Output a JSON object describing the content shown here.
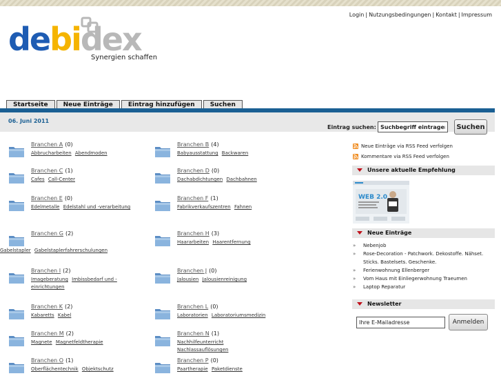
{
  "toplinks": [
    "Login",
    "Nutzungsbedingungen",
    "Kontakt",
    "Impressum"
  ],
  "logo": {
    "part1": "de",
    "part2": "bi",
    "part3": "dex",
    "tagline": "Synergien schaffen"
  },
  "tabs": [
    "Startseite",
    "Neue Einträge",
    "Eintrag hinzufügen",
    "Suchen"
  ],
  "date": "06. Juni 2011",
  "search": {
    "label": "Eintrag suchen:",
    "value": "Suchbegriff eintragen",
    "button": "Suchen"
  },
  "categories": [
    {
      "name": "Branchen A",
      "count": "(0)",
      "subs": [
        "Abbrucharbeiten",
        "Abendmoden"
      ]
    },
    {
      "name": "Branchen B",
      "count": "(4)",
      "subs": [
        "Babyausstattung",
        "Backwaren"
      ]
    },
    {
      "name": "Branchen C",
      "count": "(1)",
      "subs": [
        "Cafes",
        "Call-Center"
      ]
    },
    {
      "name": "Branchen D",
      "count": "(0)",
      "subs": [
        "Dachabdichtungen",
        "Dachbahnen"
      ]
    },
    {
      "name": "Branchen E",
      "count": "(0)",
      "subs": [
        "Edelmetalle",
        "Edelstahl und -verarbeitung"
      ]
    },
    {
      "name": "Branchen F",
      "count": "(1)",
      "subs": [
        "Fabrikverkaufszentren",
        "Fahnen"
      ]
    },
    {
      "name": "Branchen G",
      "count": "(2)",
      "subs": [
        "Gabelstapler",
        "Gabelstaplerfahrerschulungen"
      ]
    },
    {
      "name": "Branchen H",
      "count": "(3)",
      "subs": [
        "Haararbeiten",
        "Haarentfernung"
      ]
    },
    {
      "name": "Branchen I",
      "count": "(2)",
      "subs": [
        "Imageberatung",
        "Imbissbedarf und -einrichtungen"
      ]
    },
    {
      "name": "Branchen J",
      "count": "(0)",
      "subs": [
        "Jalousien",
        "Jalousienreinigung"
      ]
    },
    {
      "name": "Branchen K",
      "count": "(2)",
      "subs": [
        "Kabaretts",
        "Kabel"
      ]
    },
    {
      "name": "Branchen L",
      "count": "(0)",
      "subs": [
        "Laboratorien",
        "Laboratoriumsmedizin"
      ]
    },
    {
      "name": "Branchen M",
      "count": "(2)",
      "subs": [
        "Magnete",
        "Magnetfeldtherapie"
      ]
    },
    {
      "name": "Branchen N",
      "count": "(1)",
      "subs": [
        "Nachhilfeunterricht",
        "Nachlassauflösungen"
      ]
    },
    {
      "name": "Branchen O",
      "count": "(1)",
      "subs": [
        "Oberflächentechnik",
        "Objektschutz"
      ]
    },
    {
      "name": "Branchen P",
      "count": "(0)",
      "subs": [
        "Paartherapie",
        "Paketdienste"
      ]
    }
  ],
  "rss": [
    "Neue Einträge via RSS Feed verfolgen",
    "Kommentare via RSS Feed verfolgen"
  ],
  "sidebar": {
    "recommend_heading": "Unsere aktuelle Empfehlung",
    "recommend_image_text": "WEB 2.0",
    "entries_heading": "Neue Einträge",
    "entries": [
      "Nebenjob",
      "Rose-Decoration - Patchwork. Dekostoffe. Nähset. Sticks. Bastelsets. Geschenke.",
      "Ferienwohnung Ellenberger",
      "Vom Haus mit Einliegerwohnung Traeumen",
      "Laptop Reparatur"
    ],
    "newsletter_heading": "Newsletter",
    "newsletter_value": "Ihre E-Mailadresse",
    "newsletter_button": "Anmelden"
  },
  "colors": {
    "brand_blue": "#1a5f93",
    "logo_blue": "#1e5cb3",
    "logo_yellow": "#f5b400",
    "logo_grey": "#b8b8b8",
    "triangle_red": "#c0101a"
  }
}
